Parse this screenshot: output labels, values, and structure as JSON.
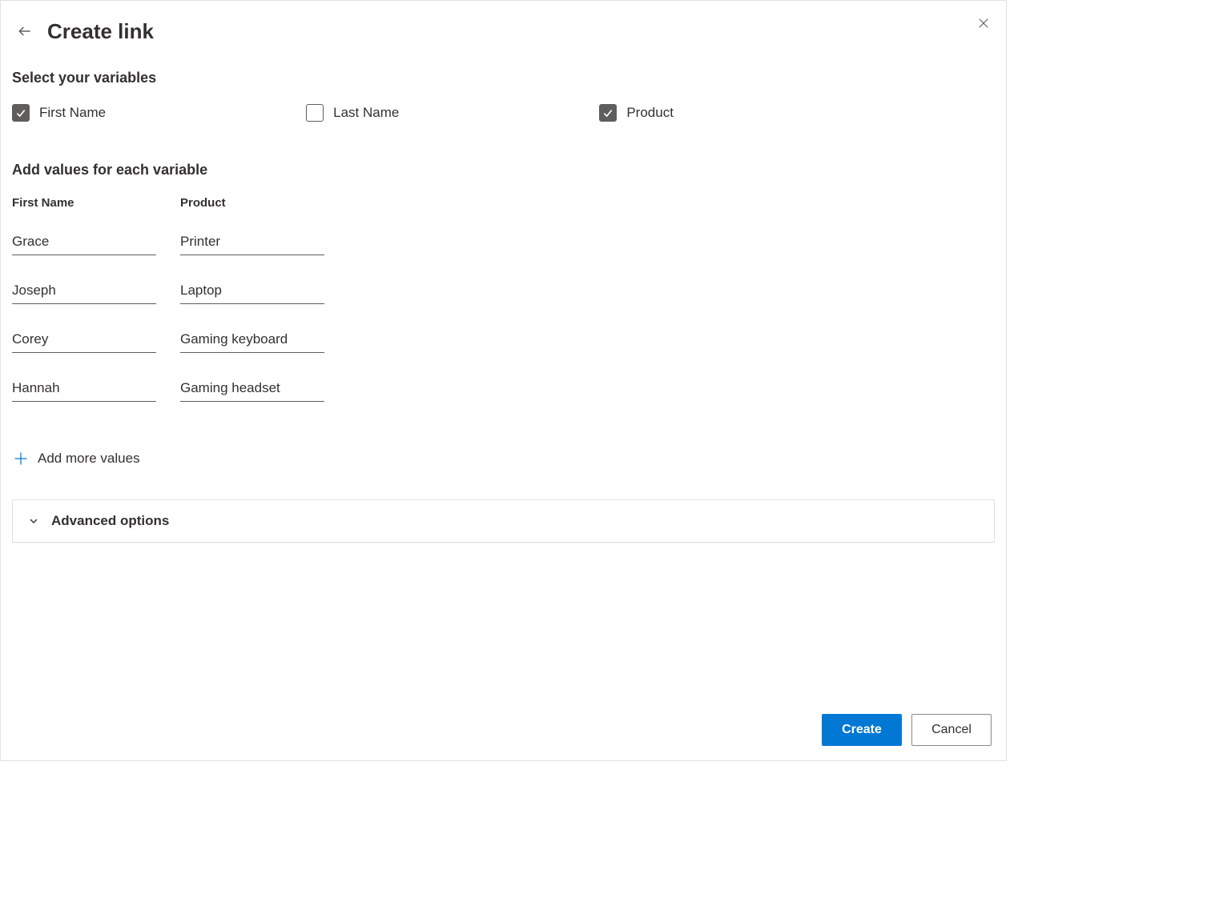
{
  "header": {
    "title": "Create link"
  },
  "variables_section": {
    "heading": "Select your variables",
    "options": [
      {
        "label": "First Name",
        "checked": true
      },
      {
        "label": "Last Name",
        "checked": false
      },
      {
        "label": "Product",
        "checked": true
      }
    ]
  },
  "values_section": {
    "heading": "Add values for each variable",
    "columns": [
      {
        "header": "First Name",
        "values": [
          "Grace",
          "Joseph",
          "Corey",
          "Hannah"
        ]
      },
      {
        "header": "Product",
        "values": [
          "Printer",
          "Laptop",
          "Gaming keyboard",
          "Gaming headset"
        ]
      }
    ],
    "add_more_label": "Add more values"
  },
  "advanced": {
    "label": "Advanced options"
  },
  "footer": {
    "create_label": "Create",
    "cancel_label": "Cancel"
  }
}
